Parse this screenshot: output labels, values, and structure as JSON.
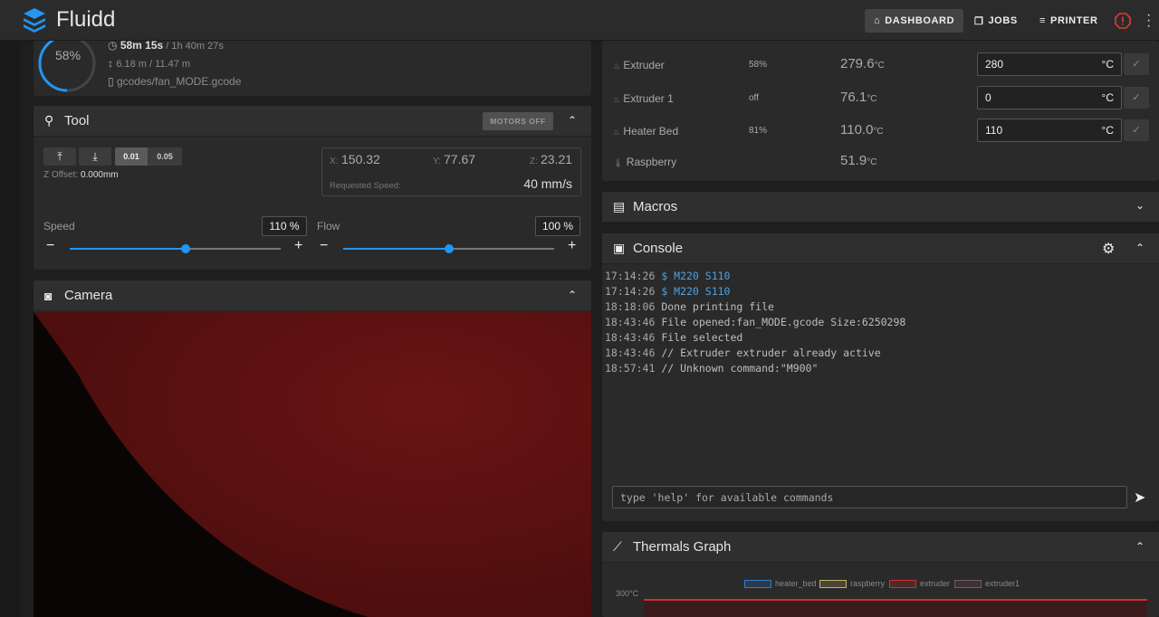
{
  "app": {
    "name": "Fluidd"
  },
  "nav": {
    "dashboard": "DASHBOARD",
    "jobs": "JOBS",
    "printer": "PRINTER"
  },
  "status": {
    "progress": "58%",
    "elapsed": "58m 15s",
    "total": " / 1h 40m 27s",
    "filament": "6.18 m / 11.47 m",
    "file": "gcodes/fan_MODE.gcode"
  },
  "tool": {
    "title": "Tool",
    "motors_off": "MOTORS OFF",
    "step_a": "0.01",
    "step_b": "0.05",
    "zoffset_label": "Z Offset:",
    "zoffset_value": "0.000mm",
    "x_label": "X:",
    "x": "150.32",
    "y_label": "Y:",
    "y": "77.67",
    "z_label": "Z:",
    "z": "23.21",
    "req_speed_label": "Requested Speed:",
    "req_speed": "40 mm/s",
    "speed_label": "Speed",
    "speed_value": "110 %",
    "flow_label": "Flow",
    "flow_value": "100 %",
    "speed_fraction": 0.55,
    "flow_fraction": 0.5
  },
  "camera": {
    "title": "Camera"
  },
  "heaters": [
    {
      "name": "Extruder",
      "power": "58%",
      "temp": "279.6",
      "unit": "°C",
      "target": "280",
      "target_unit": "°C"
    },
    {
      "name": "Extruder 1",
      "power": "off",
      "temp": "76.1",
      "unit": "°C",
      "target": "0",
      "target_unit": "°C"
    },
    {
      "name": "Heater Bed",
      "power": "81%",
      "temp": "110.0",
      "unit": "°C",
      "target": "110",
      "target_unit": "°C"
    }
  ],
  "sensor": {
    "name": "Raspberry",
    "temp": "51.9",
    "unit": "°C"
  },
  "macros": {
    "title": "Macros"
  },
  "console": {
    "title": "Console",
    "placeholder": "type 'help' for available commands",
    "lines": [
      {
        "time": "17:14:26",
        "text": "$ M220 S110",
        "cmd": true
      },
      {
        "time": "17:14:26",
        "text": "$ M220 S110",
        "cmd": true
      },
      {
        "time": "18:18:06",
        "text": "Done printing file",
        "cmd": false
      },
      {
        "time": "18:43:46",
        "text": "File opened:fan_MODE.gcode Size:6250298",
        "cmd": false
      },
      {
        "time": "18:43:46",
        "text": "File selected",
        "cmd": false
      },
      {
        "time": "18:43:46",
        "text": "// Extruder extruder already active",
        "cmd": false
      },
      {
        "time": "18:57:41",
        "text": "// Unknown command:\"M900\"",
        "cmd": false
      }
    ]
  },
  "thermals": {
    "title": "Thermals Graph",
    "legend": [
      {
        "name": "heater_bed",
        "color": "#2f7fd0"
      },
      {
        "name": "raspberry",
        "color": "#c9b26a"
      },
      {
        "name": "extruder",
        "color": "#d32f2f"
      },
      {
        "name": "extruder1",
        "color": "#7a5a66"
      }
    ],
    "ytick_top": "300°C"
  },
  "colors": {
    "accent": "#2196f3",
    "danger": "#e53935"
  }
}
